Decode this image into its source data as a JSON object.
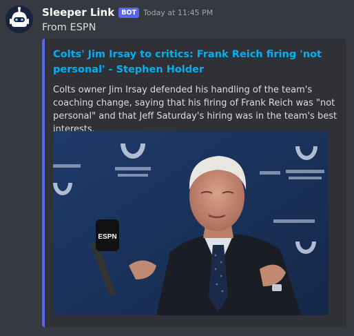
{
  "message": {
    "author": "Sleeper Link",
    "bot_tag": "BOT",
    "timestamp": "Today at 11:45 PM",
    "content": "From ESPN"
  },
  "embed": {
    "title": "Colts' Jim Irsay to critics: Frank Reich firing 'not personal' - Stephen Holder",
    "description": "Colts owner Jim Irsay defended his handling of the team's coaching change, saying that his firing of Frank Reich was \"not personal\" and that Jeff Saturday's hiring was in the team's best interests.",
    "accent_color": "#5865f2",
    "title_color": "#00aff4"
  },
  "icons": {
    "avatar": "sleeper-robot-icon"
  }
}
